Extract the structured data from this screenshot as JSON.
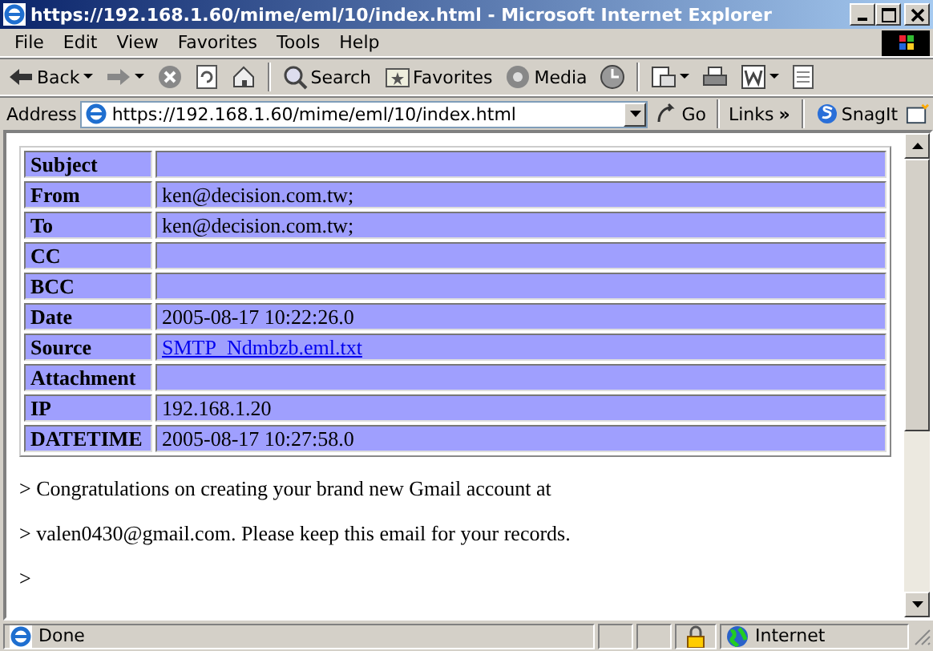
{
  "window": {
    "title": "https://192.168.1.60/mime/eml/10/index.html - Microsoft Internet Explorer"
  },
  "menu": [
    "File",
    "Edit",
    "View",
    "Favorites",
    "Tools",
    "Help"
  ],
  "toolbar": [
    {
      "kind": "back",
      "label": "Back",
      "dropdown": true
    },
    {
      "kind": "forward",
      "dropdown": true
    },
    {
      "kind": "stop",
      "dropdown": false
    },
    {
      "kind": "refresh",
      "dropdown": false
    },
    {
      "kind": "home",
      "dropdown": false
    },
    {
      "kind": "search",
      "label": "Search",
      "dropdown": false
    },
    {
      "kind": "favorites",
      "label": "Favorites",
      "dropdown": false
    },
    {
      "kind": "media",
      "label": "Media",
      "dropdown": false
    },
    {
      "kind": "history",
      "dropdown": false
    },
    {
      "kind": "mail",
      "dropdown": true
    },
    {
      "kind": "print",
      "dropdown": false
    },
    {
      "kind": "edit",
      "dropdown": true
    },
    {
      "kind": "discuss",
      "dropdown": false
    }
  ],
  "address": {
    "label": "Address",
    "value": "https://192.168.1.60/mime/eml/10/index.html",
    "go": "Go",
    "links": "Links",
    "chevron": "»",
    "snagit": "SnagIt"
  },
  "table": {
    "rows": [
      {
        "label": "Subject"
      },
      {
        "label": "From",
        "value": "ken@decision.com.tw;"
      },
      {
        "label": "To",
        "value": "ken@decision.com.tw;"
      },
      {
        "label": "CC"
      },
      {
        "label": "BCC"
      },
      {
        "label": "Date",
        "value": "2005-08-17 10:22:26.0"
      },
      {
        "label": "Source",
        "link": "SMTP_Ndmbzb.eml.txt"
      },
      {
        "label": "Attachment"
      },
      {
        "label": "IP",
        "value": "192.168.1.20"
      },
      {
        "label": "DATETIME",
        "value": "2005-08-17 10:27:58.0"
      }
    ]
  },
  "body": [
    "> Congratulations on creating your brand new Gmail account at",
    "> valen0430@gmail.com. Please keep this email for your records.",
    ">"
  ],
  "status_bar": {
    "text": "Done",
    "zone": "Internet"
  }
}
